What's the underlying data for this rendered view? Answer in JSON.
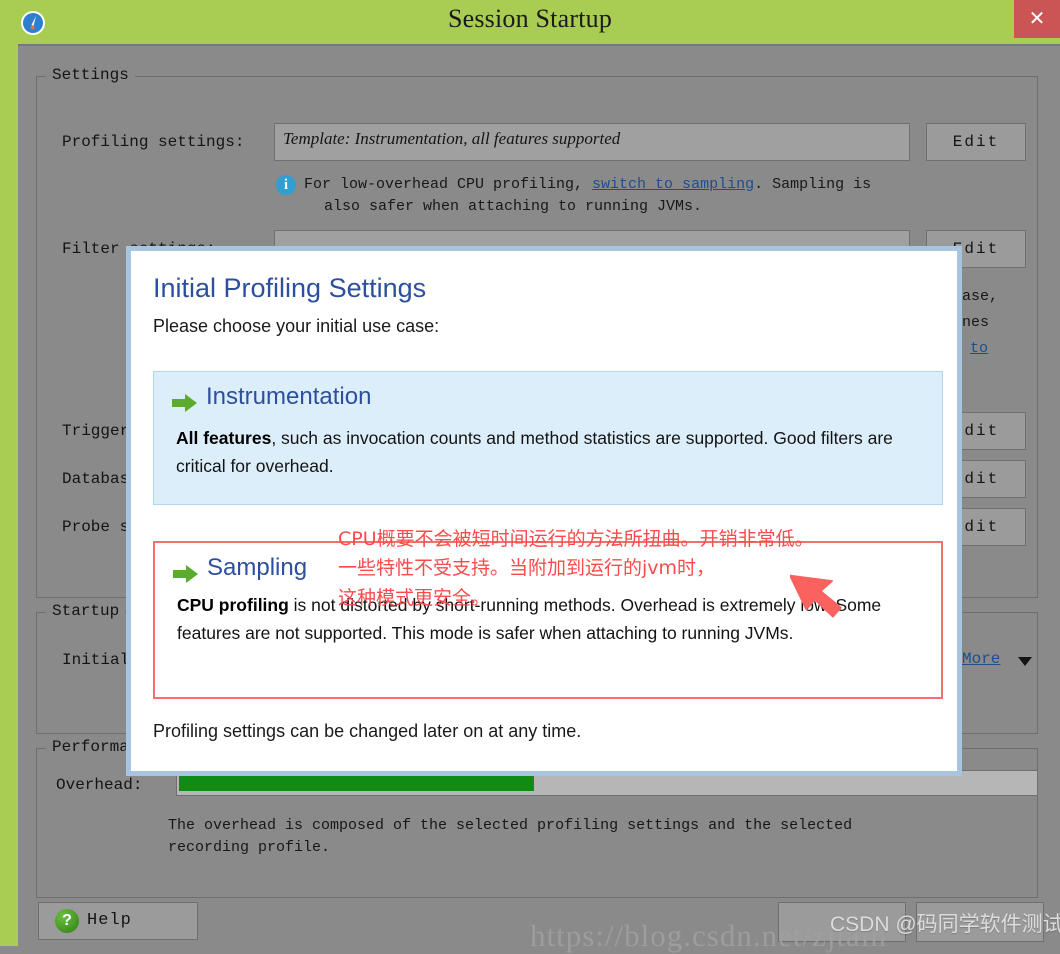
{
  "window": {
    "title": "Session Startup",
    "icon": "compass-icon",
    "close_label": "✕",
    "titlebar_color": "#a9cc52",
    "close_color": "#cb5454"
  },
  "settings_group": {
    "title": "Settings",
    "rows": [
      {
        "label": "Profiling settings:",
        "value": "Template: Instrumentation, all features supported",
        "button": "Edit"
      },
      {
        "label": "Filter settings:",
        "value": "",
        "button": "Edit"
      },
      {
        "label": "Trigger settings:",
        "value": "",
        "button": "Edit"
      },
      {
        "label": "Database settings:",
        "value": "",
        "button": "Edit"
      },
      {
        "label": "Probe settings:",
        "value": "",
        "button": "Edit"
      }
    ],
    "hint": {
      "icon": "info-icon",
      "line1_pre": "For low-overhead CPU profiling, ",
      "link": "switch to sampling",
      "line1_post": ". Sampling is",
      "line2": "also safer when attaching to running JVMs."
    },
    "occluded_right_fragments": [
      "ase,",
      "nes",
      "to"
    ]
  },
  "startup_group": {
    "title": "Startup",
    "row_label": "Initial recording profile:",
    "more_label": "More",
    "more_caret": "chevron-down-icon"
  },
  "performance_group": {
    "title": "Performance",
    "overhead_label": "Overhead:",
    "overhead_percent": 42,
    "overhead_color": "#0f8b16",
    "note_line1": "The overhead is composed of the selected profiling settings and the selected",
    "note_line2": "recording profile."
  },
  "footer": {
    "help_label": "Help",
    "help_icon": "question-mark-icon"
  },
  "dialog": {
    "title": "Initial Profiling Settings",
    "subtitle": "Please choose your initial use case:",
    "title_color": "#2c4f9e",
    "options": [
      {
        "name": "instrumentation",
        "bullet": "green-arrow-icon",
        "title": "Instrumentation",
        "desc_bold": "All features",
        "desc_rest": ", such as invocation counts and method statistics are supported. Good filters are critical for overhead.",
        "selected_bg": "#ddeefb"
      },
      {
        "name": "sampling",
        "bullet": "green-arrow-icon",
        "title": "Sampling",
        "desc_bold": "CPU profiling",
        "desc_rest": " is not distorted by short-running methods. Overhead is extremely low. Some features are not supported. This mode is safer when attaching to running JVMs.",
        "highlight_border": "#f4706e"
      }
    ],
    "footnote": "Profiling settings can be changed later on at any time."
  },
  "annotation": {
    "color": "#fb4b4b",
    "line1": "CPU概要不会被短时间运行的方法所扭曲。开销非常低。",
    "line2": "一些特性不受支持。当附加到运行的jvm时，",
    "line3": "这种模式更安全。",
    "arrow": "red-pointer-arrow"
  },
  "watermark": {
    "url": "https://blog.csdn.net/zjtain",
    "csdn": "CSDN @码同学软件测试"
  }
}
